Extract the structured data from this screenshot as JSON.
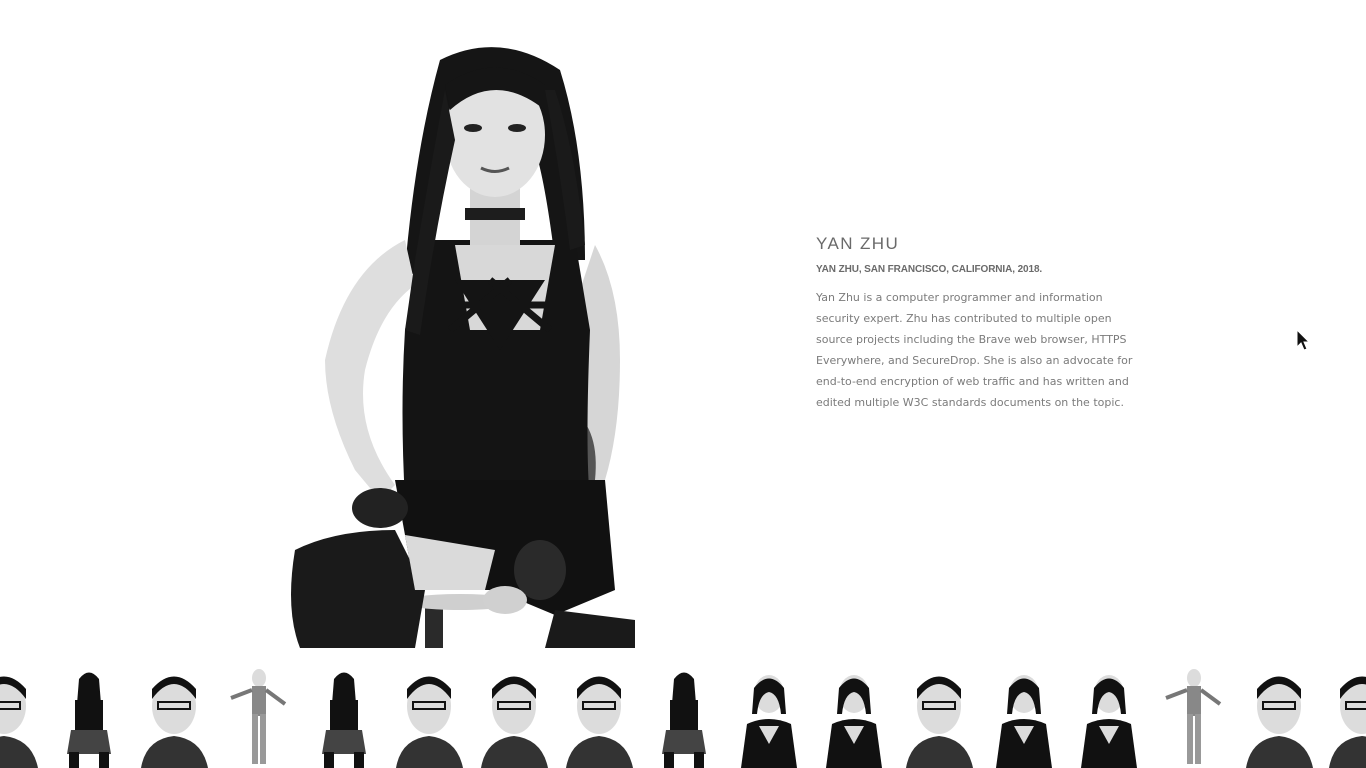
{
  "profile": {
    "name": "YAN ZHU",
    "caption": "YAN ZHU, SAN FRANCISCO, CALIFORNIA, 2018.",
    "bio": "Yan Zhu is a computer programmer and information security expert. Zhu has contributed to multiple open source projects including the Brave web browser, HTTPS Everywhere, and SecureDrop. She is also an advocate for end-to-end encryption of web traffic and has written and edited multiple W3C standards documents on the topic."
  },
  "thumbnails": [
    {
      "name": "thumb-portrait-1",
      "pose": "head"
    },
    {
      "name": "thumb-portrait-2",
      "pose": "seated"
    },
    {
      "name": "thumb-portrait-3",
      "pose": "head"
    },
    {
      "name": "thumb-portrait-4",
      "pose": "standing"
    },
    {
      "name": "thumb-portrait-5",
      "pose": "seated"
    },
    {
      "name": "thumb-portrait-6",
      "pose": "head"
    },
    {
      "name": "thumb-portrait-7",
      "pose": "head"
    },
    {
      "name": "thumb-portrait-8",
      "pose": "head"
    },
    {
      "name": "thumb-portrait-9",
      "pose": "seated"
    },
    {
      "name": "thumb-portrait-10",
      "pose": "bust"
    },
    {
      "name": "thumb-portrait-11",
      "pose": "bust"
    },
    {
      "name": "thumb-portrait-12",
      "pose": "head"
    },
    {
      "name": "thumb-portrait-13",
      "pose": "bust"
    },
    {
      "name": "thumb-portrait-14",
      "pose": "bust"
    },
    {
      "name": "thumb-portrait-15",
      "pose": "standing"
    },
    {
      "name": "thumb-portrait-16",
      "pose": "head"
    },
    {
      "name": "thumb-portrait-17",
      "pose": "head"
    }
  ],
  "colors": {
    "background": "#ffffff",
    "heading": "#6a6a6a",
    "body_text": "#7b7b7b",
    "photo_dark": "#111111",
    "photo_skin": "#dcdcdc"
  }
}
